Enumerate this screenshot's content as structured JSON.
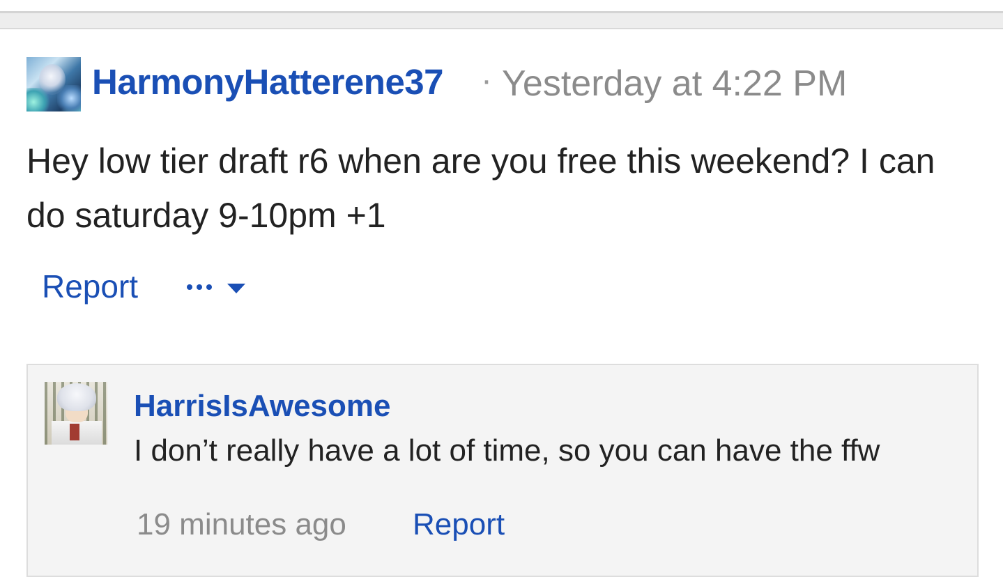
{
  "post": {
    "username": "HarmonyHatterene37",
    "separator": "·",
    "timestamp": "Yesterday at 4:22 PM",
    "body": "Hey low tier draft r6 when are you free this weekend? I can do saturday 9-10pm +1",
    "report_label": "Report",
    "avatar_icon": "user-avatar-icon",
    "more_icon": "more-options-icon"
  },
  "reply": {
    "username": "HarrisIsAwesome",
    "body": "I don’t really have a lot of time, so you can have the ffw",
    "timestamp": "19 minutes ago",
    "report_label": "Report",
    "avatar_icon": "user-avatar-icon"
  },
  "colors": {
    "link": "#1a4fb5",
    "muted": "#8b8b8b",
    "text": "#222222",
    "reply_bg": "#f4f4f4"
  }
}
